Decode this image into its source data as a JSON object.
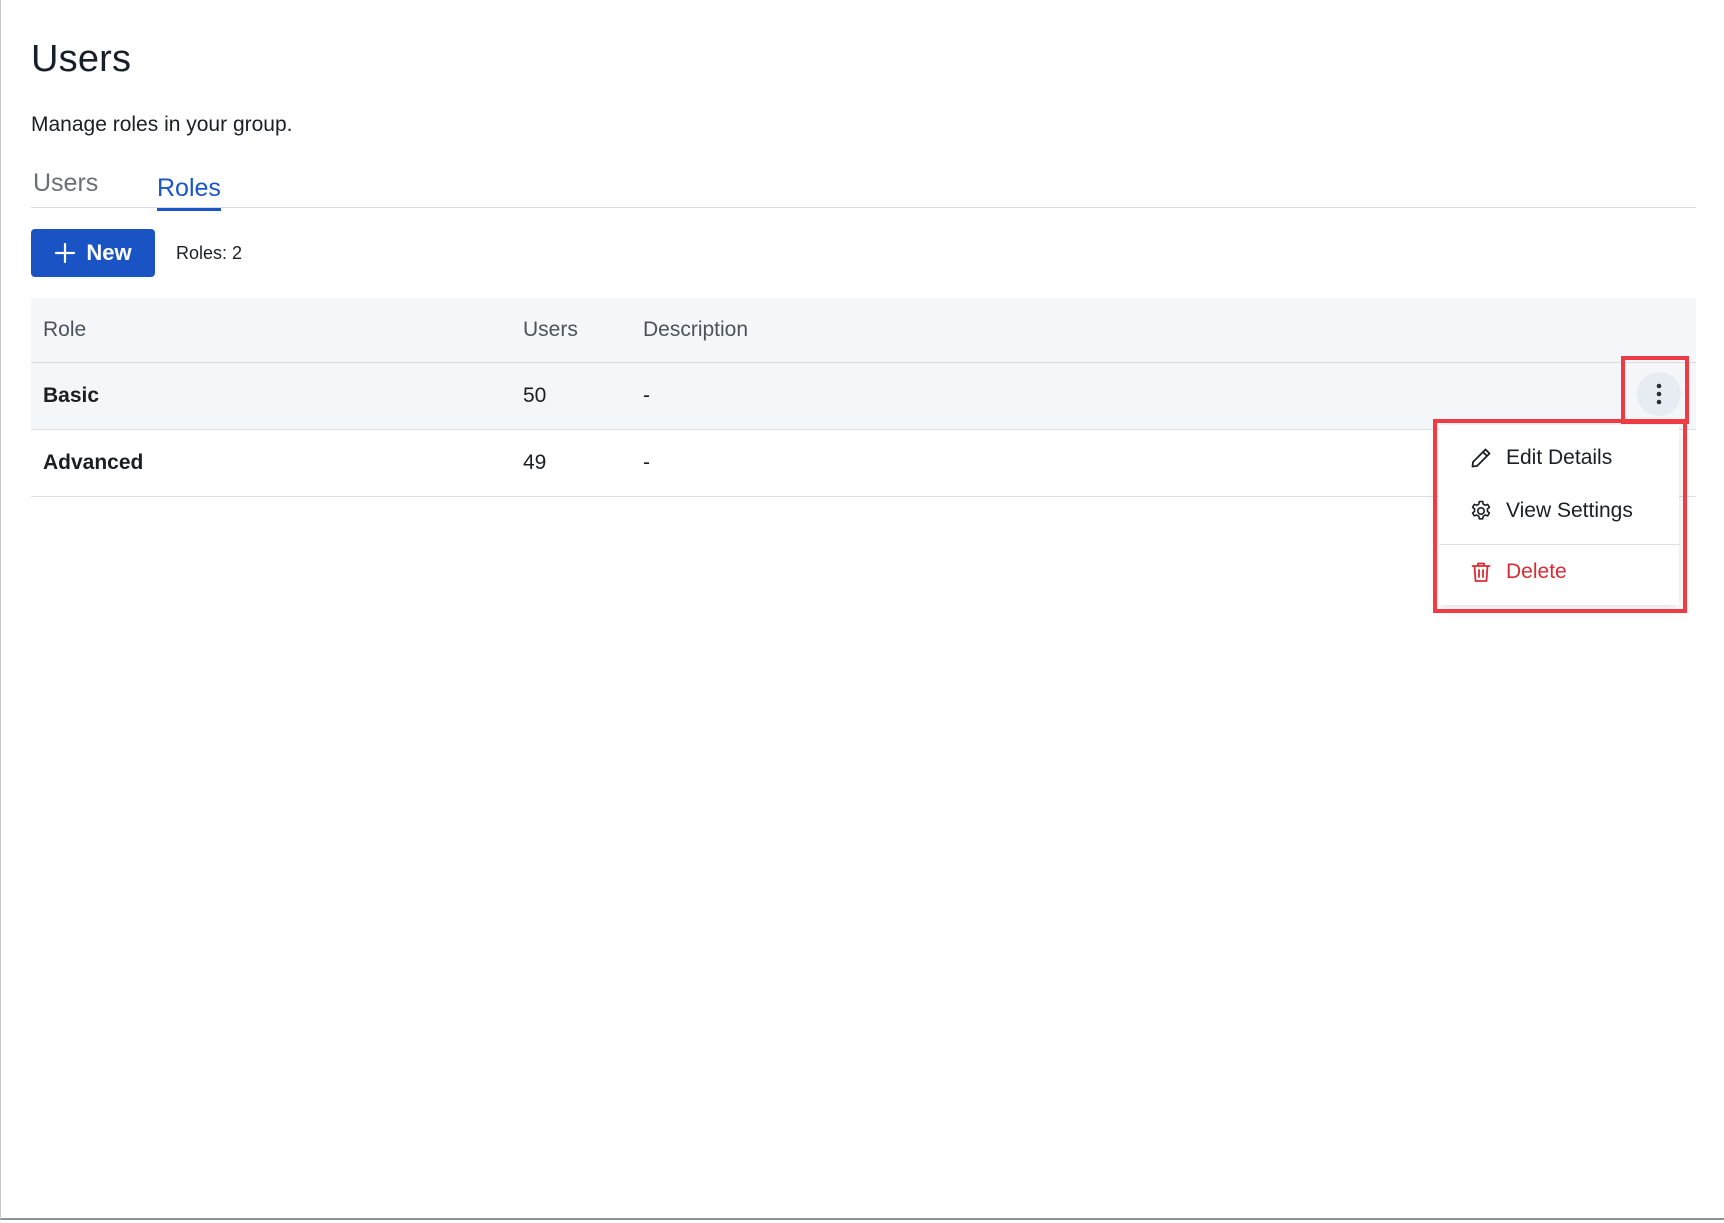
{
  "header": {
    "title": "Users",
    "subtitle": "Manage roles in your group."
  },
  "tabs": [
    {
      "label": "Users",
      "active": false
    },
    {
      "label": "Roles",
      "active": true
    }
  ],
  "toolbar": {
    "new_label": "New",
    "roles_count": "Roles: 2"
  },
  "table": {
    "columns": [
      "Role",
      "Users",
      "Description"
    ],
    "rows": [
      {
        "role": "Basic",
        "users": "50",
        "description": "-"
      },
      {
        "role": "Advanced",
        "users": "49",
        "description": "-"
      }
    ]
  },
  "row_menu": {
    "items": [
      {
        "label": "Edit Details",
        "icon": "pencil-icon"
      },
      {
        "label": "View Settings",
        "icon": "gear-icon"
      },
      {
        "label": "Delete",
        "icon": "trash-icon"
      }
    ]
  },
  "colors": {
    "accent": "#1a54c4",
    "danger": "#d92b33",
    "highlight": "#ef3b44"
  }
}
